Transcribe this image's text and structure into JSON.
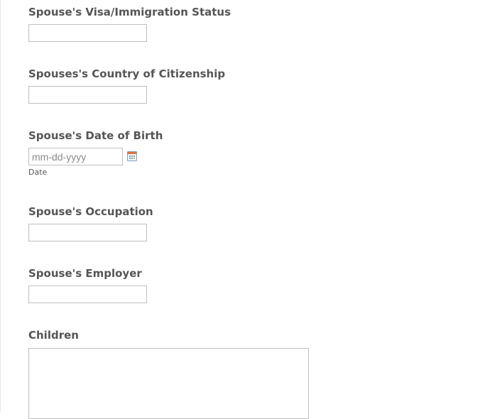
{
  "form": {
    "spouse_visa_status": {
      "label": "Spouse's Visa/Immigration Status",
      "value": ""
    },
    "spouse_citizenship": {
      "label": "Spouses's Country of Citizenship",
      "value": ""
    },
    "spouse_dob": {
      "label": "Spouse's Date of Birth",
      "placeholder": "mm-dd-yyyy",
      "sublabel": "Date",
      "icon": "calendar-icon"
    },
    "spouse_occupation": {
      "label": "Spouse's Occupation",
      "value": ""
    },
    "spouse_employer": {
      "label": "Spouse's Employer",
      "value": ""
    },
    "children": {
      "label": "Children",
      "value": ""
    }
  }
}
